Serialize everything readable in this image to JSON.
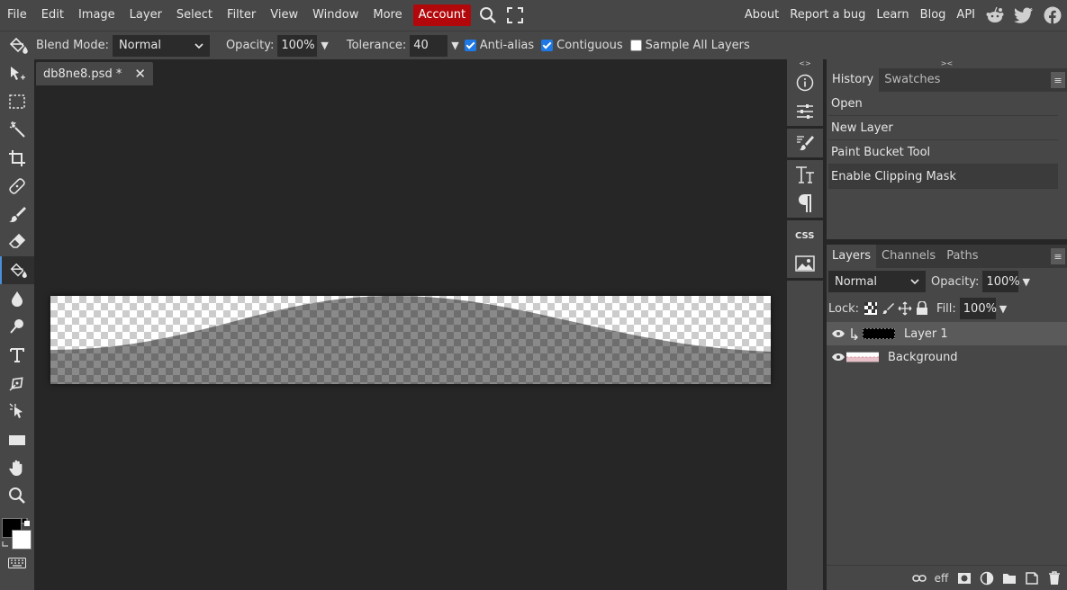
{
  "menu": {
    "items": [
      "File",
      "Edit",
      "Image",
      "Layer",
      "Select",
      "Filter",
      "View",
      "Window",
      "More"
    ],
    "account": "Account",
    "right": [
      "About",
      "Report a bug",
      "Learn",
      "Blog",
      "API"
    ]
  },
  "options": {
    "blend_label": "Blend Mode:",
    "blend_value": "Normal",
    "opacity_label": "Opacity:",
    "opacity_value": "100%",
    "tolerance_label": "Tolerance:",
    "tolerance_value": "40",
    "antialias_label": "Anti-alias",
    "contiguous_label": "Contiguous",
    "sample_label": "Sample All Layers"
  },
  "document": {
    "tab_name": "db8ne8.psd *",
    "close": "✕"
  },
  "mini_header": "<>",
  "panel_header": "><",
  "history": {
    "tabs": [
      "History",
      "Swatches"
    ],
    "items": [
      "Open",
      "New Layer",
      "Paint Bucket Tool",
      "Enable Clipping Mask"
    ]
  },
  "layers": {
    "tabs": [
      "Layers",
      "Channels",
      "Paths"
    ],
    "blend_value": "Normal",
    "opacity_label": "Opacity:",
    "opacity_value": "100%",
    "lock_label": "Lock:",
    "fill_label": "Fill:",
    "fill_value": "100%",
    "list": [
      "Layer 1",
      "Background"
    ],
    "bottom_label": "eff"
  },
  "colors": {
    "accent": "#b3080b",
    "panel": "#474747",
    "workspace": "#262626",
    "checkbox": "#1e78e6"
  }
}
